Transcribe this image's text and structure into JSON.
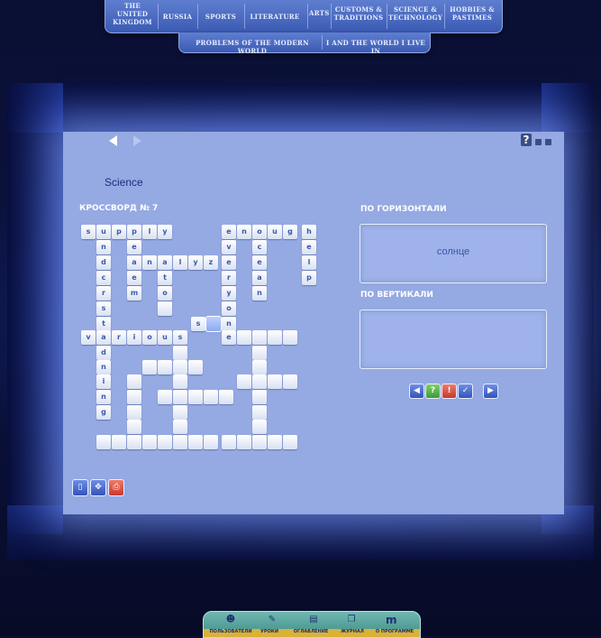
{
  "nav": {
    "row1": [
      "THE UNITED KINGDOM",
      "RUSSIA",
      "SPORTS",
      "LITERATURE",
      "ARTS",
      "CUSTOMS & TRADITIONS",
      "SCIENCE & TECHNOLOGY",
      "HOBBIES & PASTIMES"
    ],
    "row2": [
      "PROBLEMS OF THE MODERN WORLD",
      "I AND THE WORLD I LIVE IN"
    ]
  },
  "lesson": {
    "subject": "Science",
    "crossword_title": "КРОССВОРД № 7"
  },
  "crossword": {
    "letters": {
      "supply": [
        "s",
        "u",
        "p",
        "p",
        "l",
        "y"
      ],
      "enough": [
        "e",
        "n",
        "o",
        "u",
        "g",
        "h"
      ],
      "analyze": [
        "a",
        "n",
        "a",
        "l",
        "y",
        "z",
        "e"
      ],
      "various": [
        "v",
        "a",
        "r",
        "i",
        "o",
        "u",
        "s"
      ],
      "col_letters": [
        "n",
        "d",
        "e",
        "r",
        "s",
        "t",
        "a",
        "n",
        "d",
        "i",
        "n",
        "g"
      ],
      "other": [
        "e",
        "c",
        "e",
        "t",
        "o",
        "m",
        "v",
        "r",
        "y",
        "o",
        "c",
        "e",
        "a",
        "n",
        "e",
        "l",
        "p",
        "s",
        "n",
        "e"
      ]
    }
  },
  "clues": {
    "across_header": "ПО ГОРИЗОНТАЛИ",
    "across_text": "солнце",
    "down_header": "ПО ВЕРТИКАЛИ",
    "down_text": ""
  },
  "icons": {
    "help": "?",
    "controls": [
      "prev-icon",
      "hint-icon",
      "info-icon",
      "check-icon",
      "next-icon"
    ],
    "controls_glyphs": [
      "◀",
      "?",
      "!",
      "✓",
      "▶"
    ],
    "tools": [
      "document-icon",
      "move-icon",
      "print-icon"
    ]
  },
  "bottom": {
    "items": [
      "ПОЛЬЗОВАТЕЛИ",
      "УРОКИ",
      "ОГЛАВЛЕНИЕ",
      "ЖУРНАЛ",
      "О ПРОГРАММЕ"
    ],
    "logo": "m"
  },
  "colors": {
    "panel": "#95a9e2",
    "accent": "#3553b8",
    "bottom_bar": "#3f8e86",
    "bottom_strip": "#d9b23a"
  }
}
